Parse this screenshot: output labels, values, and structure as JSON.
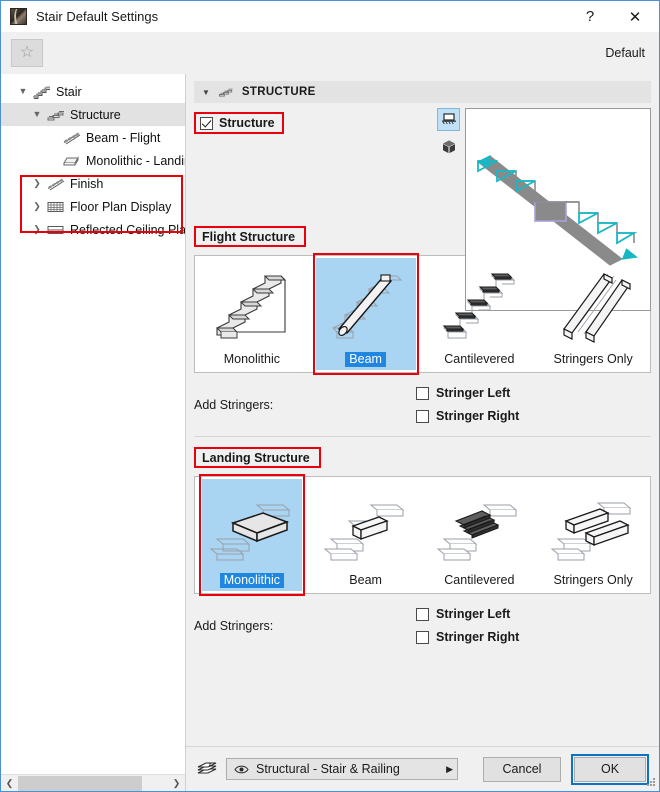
{
  "window": {
    "title": "Stair Default Settings",
    "help_label": "?",
    "close_label": "✕",
    "favorite_icon": "star-icon",
    "default_label": "Default"
  },
  "sidebar": {
    "items": [
      {
        "label": "Stair",
        "icon": "stair-icon",
        "twisty": "▼",
        "depth": 0,
        "selected": false
      },
      {
        "label": "Structure",
        "icon": "structure-icon",
        "twisty": "▼",
        "depth": 1,
        "selected": true
      },
      {
        "label": "Beam - Flight",
        "icon": "beam-flight-icon",
        "twisty": "",
        "depth": 2,
        "selected": false
      },
      {
        "label": "Monolithic - Landin",
        "icon": "monolithic-landing-icon",
        "twisty": "",
        "depth": 2,
        "selected": false
      },
      {
        "label": "Finish",
        "icon": "finish-icon",
        "twisty": "❯",
        "depth": 1,
        "selected": false
      },
      {
        "label": "Floor Plan Display",
        "icon": "floor-plan-display-icon",
        "twisty": "❯",
        "depth": 1,
        "selected": false
      },
      {
        "label": "Reflected Ceiling Plan",
        "icon": "reflected-ceiling-plan-icon",
        "twisty": "❯",
        "depth": 1,
        "selected": false
      }
    ],
    "scroll_left_arrow": "❮",
    "scroll_right_arrow": "❯"
  },
  "panel": {
    "caret": "▼",
    "title": "STRUCTURE",
    "icon": "structure-icon"
  },
  "structure_toggle": {
    "label": "Structure",
    "checked": true
  },
  "preview": {
    "view_modes": [
      {
        "name": "section-view",
        "selected": true
      },
      {
        "name": "3d-view",
        "selected": false
      }
    ]
  },
  "flight_structure": {
    "title": "Flight Structure",
    "options": [
      {
        "label": "Monolithic",
        "art": "monolithic-flight",
        "selected": false
      },
      {
        "label": "Beam",
        "art": "beam-flight",
        "selected": true
      },
      {
        "label": "Cantilevered",
        "art": "cantilevered-flight",
        "selected": false
      },
      {
        "label": "Stringers Only",
        "art": "stringers-only-flight",
        "selected": false
      }
    ],
    "add_stringers_label": "Add Stringers:",
    "stringer_left": {
      "label": "Stringer Left",
      "checked": false
    },
    "stringer_right": {
      "label": "Stringer Right",
      "checked": false
    }
  },
  "landing_structure": {
    "title": "Landing Structure",
    "options": [
      {
        "label": "Monolithic",
        "art": "monolithic-landing",
        "selected": true
      },
      {
        "label": "Beam",
        "art": "beam-landing",
        "selected": false
      },
      {
        "label": "Cantilevered",
        "art": "cantilevered-landing",
        "selected": false
      },
      {
        "label": "Stringers Only",
        "art": "stringers-only-landing",
        "selected": false
      }
    ],
    "add_stringers_label": "Add Stringers:",
    "stringer_left": {
      "label": "Stringer Left",
      "checked": false
    },
    "stringer_right": {
      "label": "Stringer Right",
      "checked": false
    }
  },
  "footer": {
    "layers_icon": "layers-icon",
    "layer_combo": {
      "value": "Structural - Stair & Railing",
      "icon": "eye-icon",
      "caret": "▶"
    },
    "cancel_label": "Cancel",
    "ok_label": "OK"
  },
  "colors": {
    "accent_blue": "#0d72c4",
    "selection_blue": "#a9d5f2",
    "label_highlight": "#2086e0",
    "red_annotation": "#e8000d",
    "window_bg": "#f0f0f0",
    "preview_teal": "#17b8c4",
    "preview_gray": "#8a8a8a"
  }
}
